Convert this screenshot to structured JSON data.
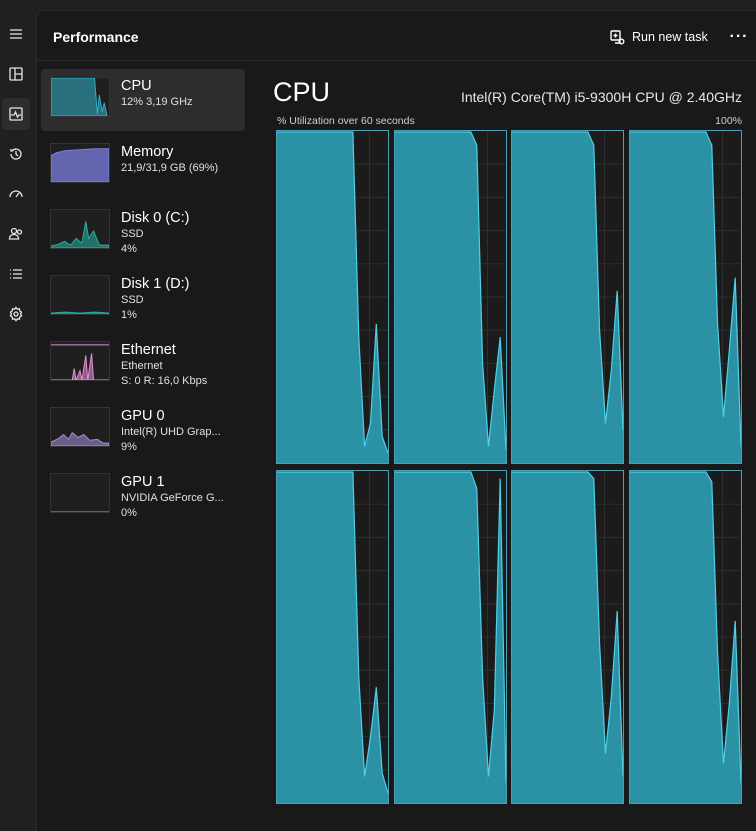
{
  "header": {
    "title": "Performance",
    "run_task_label": "Run new task",
    "more_label": "···"
  },
  "rail": [
    {
      "name": "menu-icon"
    },
    {
      "name": "processes-icon"
    },
    {
      "name": "performance-icon",
      "active": true
    },
    {
      "name": "app-history-icon"
    },
    {
      "name": "startup-apps-icon"
    },
    {
      "name": "users-icon"
    },
    {
      "name": "details-icon"
    },
    {
      "name": "services-icon"
    }
  ],
  "resources": [
    {
      "name": "CPU",
      "line1": "12% 3,19 GHz",
      "line2": "",
      "color": "#2fb3cc",
      "active": true
    },
    {
      "name": "Memory",
      "line1": "21,9/31,9 GB (69%)",
      "line2": "",
      "color": "#7b7fe0"
    },
    {
      "name": "Disk 0 (C:)",
      "line1": "SSD",
      "line2": "4%",
      "color": "#27b3a3"
    },
    {
      "name": "Disk 1 (D:)",
      "line1": "SSD",
      "line2": "1%",
      "color": "#27b3a3"
    },
    {
      "name": "Ethernet",
      "line1": "Ethernet",
      "line2": "S: 0 R: 16,0 Kbps",
      "color": "#e88fd6"
    },
    {
      "name": "GPU 0",
      "line1": "Intel(R) UHD Grap...",
      "line2": "9%",
      "color": "#a890e0"
    },
    {
      "name": "GPU 1",
      "line1": "NVIDIA GeForce G...",
      "line2": "0%",
      "color": "#a890e0"
    }
  ],
  "cpu": {
    "title": "CPU",
    "model": "Intel(R) Core(TM) i5-9300H CPU @ 2.40GHz",
    "util_label": "% Utilization over 60 seconds",
    "util_max": "100%",
    "accent": "#2fb3cc"
  },
  "chart_data": {
    "type": "area",
    "title": "",
    "xlabel": "% Utilization over 60 seconds",
    "ylabel": "",
    "ylim": [
      0,
      100
    ],
    "x": [
      0,
      1,
      2,
      3,
      4,
      5,
      6,
      7,
      8,
      9,
      10,
      11,
      12,
      13,
      14,
      15,
      16,
      17,
      18,
      19
    ],
    "series": [
      {
        "values": [
          100,
          100,
          100,
          100,
          100,
          100,
          100,
          100,
          100,
          100,
          100,
          100,
          100,
          100,
          38,
          5,
          12,
          42,
          8,
          3
        ]
      },
      {
        "values": [
          100,
          100,
          100,
          100,
          100,
          100,
          100,
          100,
          100,
          100,
          100,
          100,
          100,
          100,
          96,
          30,
          5,
          22,
          38,
          4
        ]
      },
      {
        "values": [
          100,
          100,
          100,
          100,
          100,
          100,
          100,
          100,
          100,
          100,
          100,
          100,
          100,
          100,
          96,
          40,
          12,
          28,
          52,
          10
        ]
      },
      {
        "values": [
          100,
          100,
          100,
          100,
          100,
          100,
          100,
          100,
          100,
          100,
          100,
          100,
          100,
          100,
          96,
          42,
          14,
          34,
          56,
          5
        ]
      },
      {
        "values": [
          100,
          100,
          100,
          100,
          100,
          100,
          100,
          100,
          100,
          100,
          100,
          100,
          100,
          100,
          38,
          8,
          20,
          35,
          9,
          3
        ]
      },
      {
        "values": [
          100,
          100,
          100,
          100,
          100,
          100,
          100,
          100,
          100,
          100,
          100,
          100,
          100,
          100,
          95,
          38,
          8,
          28,
          98,
          6
        ]
      },
      {
        "values": [
          100,
          100,
          100,
          100,
          100,
          100,
          100,
          100,
          100,
          100,
          100,
          100,
          100,
          100,
          98,
          48,
          15,
          32,
          58,
          8
        ]
      },
      {
        "values": [
          100,
          100,
          100,
          100,
          100,
          100,
          100,
          100,
          100,
          100,
          100,
          100,
          100,
          100,
          97,
          45,
          12,
          30,
          55,
          6
        ]
      }
    ]
  }
}
